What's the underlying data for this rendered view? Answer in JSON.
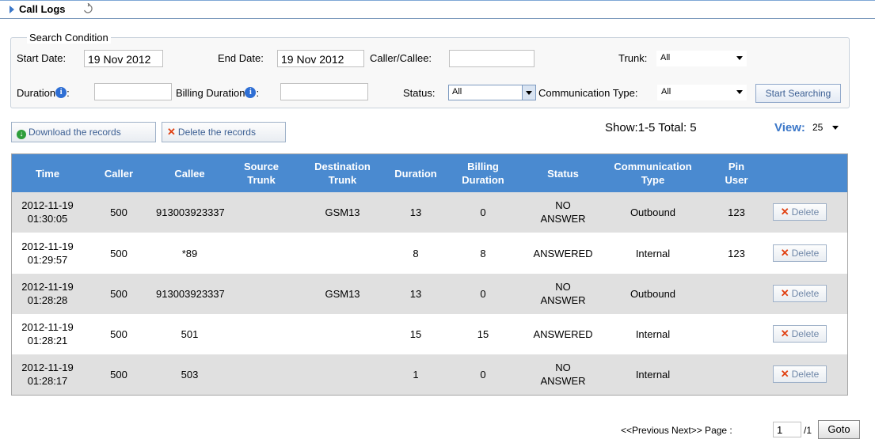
{
  "header": {
    "title": "Call Logs"
  },
  "search": {
    "legend": "Search Condition",
    "start_date_label": "Start Date:",
    "start_date_value": "19 Nov 2012",
    "end_date_label": "End Date:",
    "end_date_value": "19 Nov 2012",
    "caller_label": "Caller/Callee:",
    "caller_value": "",
    "trunk_label": "Trunk:",
    "trunk_value": "All",
    "duration_label": "Duration",
    "duration_value": "",
    "billing_duration_label": "Billing Duration",
    "billing_duration_value": "",
    "status_label": "Status:",
    "status_value": "All",
    "comm_type_label": "Communication Type:",
    "comm_type_value": "All",
    "start_button": "Start Searching"
  },
  "toolbar": {
    "download_label": "Download the records",
    "delete_label": "Delete the records",
    "show_text": "Show:1-5  Total: 5",
    "view_label": "View:",
    "view_value": "25"
  },
  "table": {
    "columns": [
      {
        "l1": "Time",
        "l2": ""
      },
      {
        "l1": "Caller",
        "l2": ""
      },
      {
        "l1": "Callee",
        "l2": ""
      },
      {
        "l1": "Source",
        "l2": "Trunk"
      },
      {
        "l1": "Destination",
        "l2": "Trunk"
      },
      {
        "l1": "Duration",
        "l2": ""
      },
      {
        "l1": "Billing",
        "l2": "Duration"
      },
      {
        "l1": "Status",
        "l2": ""
      },
      {
        "l1": "Communication",
        "l2": "Type"
      },
      {
        "l1": "Pin",
        "l2": "User"
      }
    ],
    "delete_label": "Delete",
    "rows": [
      {
        "date": "2012-11-19",
        "time": "01:30:05",
        "caller": "500",
        "callee": "913003923337",
        "source": "",
        "dest": "GSM13",
        "duration": "13",
        "billing": "0",
        "status1": "NO",
        "status2": "ANSWER",
        "type": "Outbound",
        "pin": "123"
      },
      {
        "date": "2012-11-19",
        "time": "01:29:57",
        "caller": "500",
        "callee": "*89",
        "source": "",
        "dest": "",
        "duration": "8",
        "billing": "8",
        "status1": "ANSWERED",
        "status2": "",
        "type": "Internal",
        "pin": "123"
      },
      {
        "date": "2012-11-19",
        "time": "01:28:28",
        "caller": "500",
        "callee": "913003923337",
        "source": "",
        "dest": "GSM13",
        "duration": "13",
        "billing": "0",
        "status1": "NO",
        "status2": "ANSWER",
        "type": "Outbound",
        "pin": ""
      },
      {
        "date": "2012-11-19",
        "time": "01:28:21",
        "caller": "500",
        "callee": "501",
        "source": "",
        "dest": "",
        "duration": "15",
        "billing": "15",
        "status1": "ANSWERED",
        "status2": "",
        "type": "Internal",
        "pin": ""
      },
      {
        "date": "2012-11-19",
        "time": "01:28:17",
        "caller": "500",
        "callee": "503",
        "source": "",
        "dest": "",
        "duration": "1",
        "billing": "0",
        "status1": "NO",
        "status2": "ANSWER",
        "type": "Internal",
        "pin": ""
      }
    ]
  },
  "pager": {
    "nav_text": "<<Previous Next>> Page :",
    "page_value": "1",
    "of_text": "/1",
    "goto_label": "Goto"
  }
}
